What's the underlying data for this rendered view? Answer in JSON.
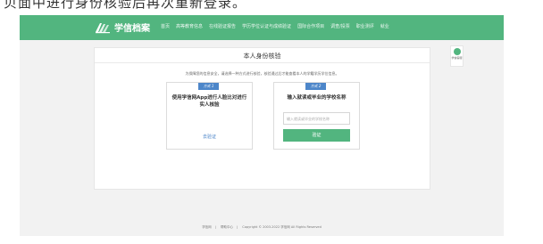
{
  "caption": "贝面中进行身份核验后再次重新登录。",
  "header": {
    "logo_text": "学信档案",
    "nav": [
      "首页",
      "高等教育信息",
      "在线验证报告",
      "学历学位认证与成绩验证",
      "国际合作项目",
      "调查/投票",
      "职业测评",
      "就业"
    ]
  },
  "main": {
    "title": "本人身份核验",
    "description": "为保障您的信息安全，请选择一种方式进行核验，核验通过后才能查看本人的学籍学历学位信息。",
    "method1": {
      "tag": "方式 1",
      "text": "使用学信网App进行人脸比对进行实人核验",
      "link": "去验证"
    },
    "method2": {
      "tag": "方式 2",
      "text": "输入就读或毕业的学校名称",
      "input_placeholder": "输入就读或毕业的学校名称",
      "button": "验证"
    }
  },
  "side_widget": {
    "label": "学信客服"
  },
  "footer": {
    "links": [
      "学信网",
      "帮助中心"
    ],
    "copyright": "Copyright © 2003-2022 学信网 All Rights Reserved"
  },
  "colors": {
    "brand_green": "#52b57f",
    "link_blue": "#4d86c9"
  }
}
